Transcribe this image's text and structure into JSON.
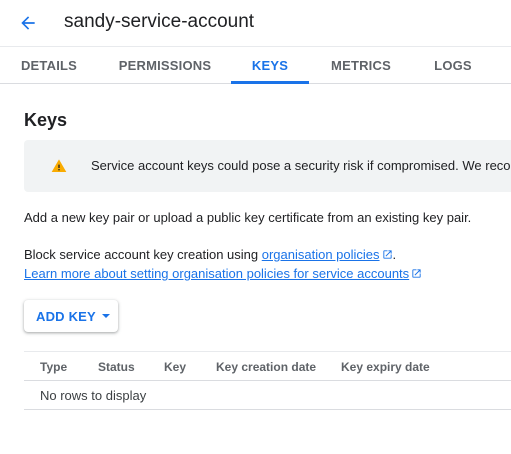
{
  "header": {
    "title": "sandy-service-account",
    "back_icon": "arrow-back-icon"
  },
  "tabs": [
    {
      "label": "DETAILS",
      "active": false
    },
    {
      "label": "PERMISSIONS",
      "active": false
    },
    {
      "label": "KEYS",
      "active": true
    },
    {
      "label": "METRICS",
      "active": false
    },
    {
      "label": "LOGS",
      "active": false
    }
  ],
  "keys": {
    "heading": "Keys",
    "warning": {
      "icon": "warning-icon",
      "text": "Service account keys could pose a security risk if compromised. We recommend"
    },
    "description": "Add a new key pair or upload a public key certificate from an existing key pair.",
    "block_text": "Block service account key creation using ",
    "block_link": "organisation policies",
    "block_suffix": ".",
    "learn_more_link": "Learn more about setting organisation policies for service accounts",
    "add_key_label": "ADD KEY"
  },
  "table": {
    "columns": [
      "Type",
      "Status",
      "Key",
      "Key creation date",
      "Key expiry date"
    ],
    "empty_message": "No rows to display"
  },
  "colors": {
    "accent": "#1a73e8",
    "warning": "#f9ab00",
    "banner_bg": "#f1f3f4"
  }
}
